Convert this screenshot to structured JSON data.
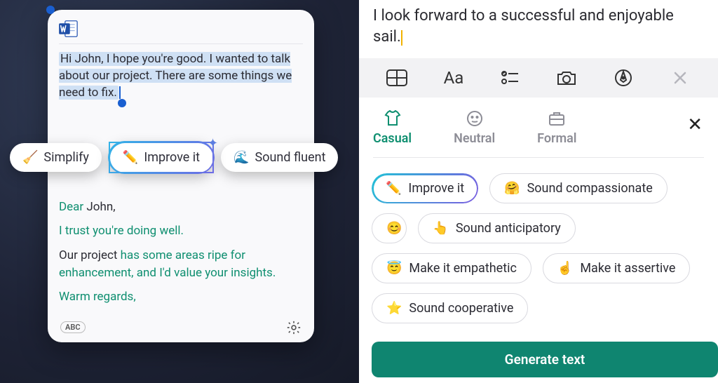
{
  "left": {
    "selected_text": "Hi John, I hope you're good. I wanted to talk about our project. There are some things we need to fix.",
    "actions": {
      "simplify": "Simplify",
      "improve": "Improve it",
      "fluent": "Sound fluent"
    },
    "rewrite": {
      "greeting_prefix": "Dear ",
      "greeting_name": "John,",
      "line2": "I trust you're doing well.",
      "line3_plain": "Our project ",
      "line3_green": "has some areas ripe for enhancement, and I'd value your insights.",
      "signoff": "Warm regards,"
    },
    "abc": "ABC"
  },
  "right": {
    "doc_text": "I look forward to a successful and enjoyable sail.",
    "toolbar_label_Aa": "Aa",
    "tabs": {
      "casual": "Casual",
      "neutral": "Neutral",
      "formal": "Formal"
    },
    "chips": {
      "improve": "Improve it",
      "compassionate": "Sound compassionate",
      "anticipatory": "Sound anticipatory",
      "empathetic": "Make it empathetic",
      "assertive": "Make it assertive",
      "cooperative": "Sound cooperative"
    },
    "generate": "Generate text"
  }
}
